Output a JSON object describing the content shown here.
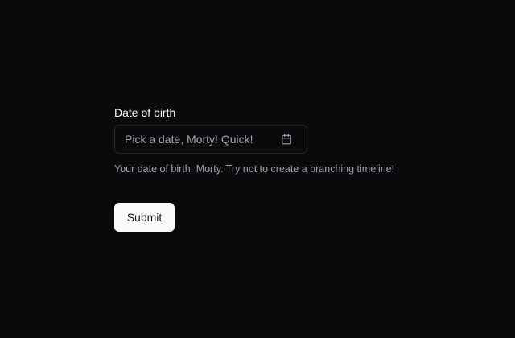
{
  "form": {
    "label": "Date of birth",
    "date_picker": {
      "placeholder": "Pick a date, Morty! Quick!",
      "icon": "calendar-icon"
    },
    "description": "Your date of birth, Morty. Try not to create a branching timeline!",
    "submit_label": "Submit"
  },
  "colors": {
    "background": "#0a0a0c",
    "label": "#fafafa",
    "muted_text": "#a1a1aa",
    "border": "#27272a",
    "button_bg": "#fafafa",
    "button_text": "#18181b"
  }
}
